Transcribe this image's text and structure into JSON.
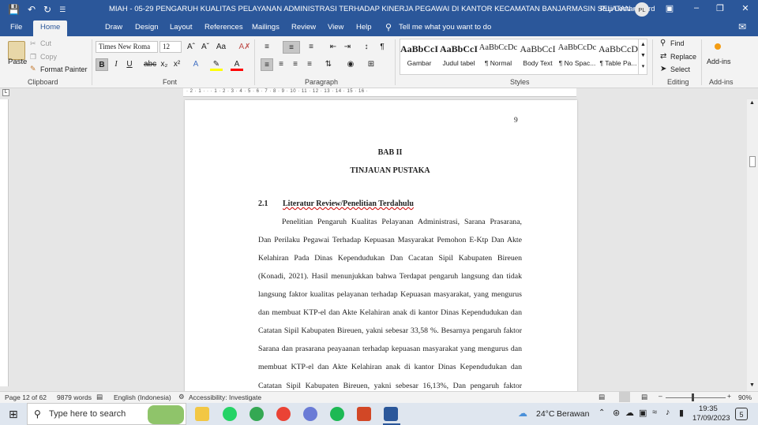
{
  "titlebar": {
    "doc_title": "MIAH - 05-29 PENGARUH KUALITAS PELAYANAN ADMINISTRASI TERHADAP KINERJA PEGAWAI DI KANTOR KECAMATAN BANJARMASIN SELATAN  -  Word",
    "user_name": "Puji Lestari",
    "avatar_initials": "PL",
    "icons": [
      "save-icon",
      "undo-icon",
      "redo-icon",
      "customize-qat-icon",
      "ribbon-display-icon",
      "minimize-icon",
      "restore-icon",
      "close-icon"
    ]
  },
  "tabs": [
    "File",
    "Home",
    "Draw",
    "Design",
    "Layout",
    "References",
    "Mailings",
    "Review",
    "View",
    "Help"
  ],
  "active_tab": "Home",
  "tell_me": "Tell me what you want to do",
  "ribbon": {
    "clipboard": {
      "paste": "Paste",
      "cut": "Cut",
      "copy": "Copy",
      "format_painter": "Format Painter",
      "label": "Clipboard"
    },
    "font": {
      "font_name": "Times New Roma",
      "font_size": "12",
      "label": "Font"
    },
    "paragraph": {
      "label": "Paragraph"
    },
    "styles": {
      "label": "Styles",
      "items": [
        {
          "preview": "AaBbCcI",
          "name": "Gambar"
        },
        {
          "preview": "AaBbCcI",
          "name": "Judul tabel"
        },
        {
          "preview": "AaBbCcDc",
          "name": "¶ Normal"
        },
        {
          "preview": "AaBbCcI",
          "name": "Body Text"
        },
        {
          "preview": "AaBbCcDc",
          "name": "¶ No Spac..."
        },
        {
          "preview": "AaBbCcD",
          "name": "¶ Table Pa..."
        }
      ]
    },
    "editing": {
      "find": "Find",
      "replace": "Replace",
      "select": "Select",
      "label": "Editing"
    },
    "addins": {
      "label": "Add-ins",
      "button": "Add-ins"
    }
  },
  "ruler_marks": "· 2 · 1 · · · 1 · 2 · 3 · 4 · 5 · 6 · 7 · 8 · 9 · 10 · 11 · 12 · 13 · 14 · 15 · 16 ·",
  "document": {
    "page_number": "9",
    "chapter": "BAB II",
    "chapter_title": "TINJAUAN PUSTAKA",
    "section_number": "2.1",
    "section_title": "Literatur Review/Penelitian Terdahulu",
    "lines": [
      "Penelitian Pengaruh Kualitas Pelayanan Administrasi, Sarana Prasarana,",
      "Dan Perilaku Pegawai Terhadap Kepuasan Masyarakat Pemohon E-Ktp Dan Akte",
      "Kelahiran Pada Dinas Kependudukan Dan Cacatan Sipil Kabupaten Bireuen",
      "(Konadi, 2021). Hasil menunjukkan bahwa Terdapat pengaruh langsung dan tidak",
      "langsung faktor kualitas pelayanan terhadap Kepuasan masyarakat, yang mengurus",
      "dan membuat KTP-el dan Akte Kelahiran anak di kantor Dinas Kependudukan dan",
      "Catatan Sipil Kabupaten Bireuen, yakni sebesar 33,58 %. Besarnya pengaruh faktor",
      "Sarana dan prasarana peayaanan terhadap kepuasan masyarakat yang mengurus dan",
      "membuat KTP-el dan Akte Kelahiran anak di kantor Dinas Kependudukan dan",
      "Catatan Sipil Kabupaten Bireuen, yakni sebesar 16,13%, Dan pengaruh faktor"
    ]
  },
  "statusbar": {
    "page": "Page 12 of 62",
    "words": "9879 words",
    "language": "English (Indonesia)",
    "accessibility": "Accessibility: Investigate",
    "zoom": "90%"
  },
  "taskbar": {
    "search_placeholder": "Type here to search",
    "weather_temp": "24°C",
    "weather_desc": "Berawan",
    "time": "19:35",
    "date": "17/09/2023",
    "notif_count": "5"
  }
}
